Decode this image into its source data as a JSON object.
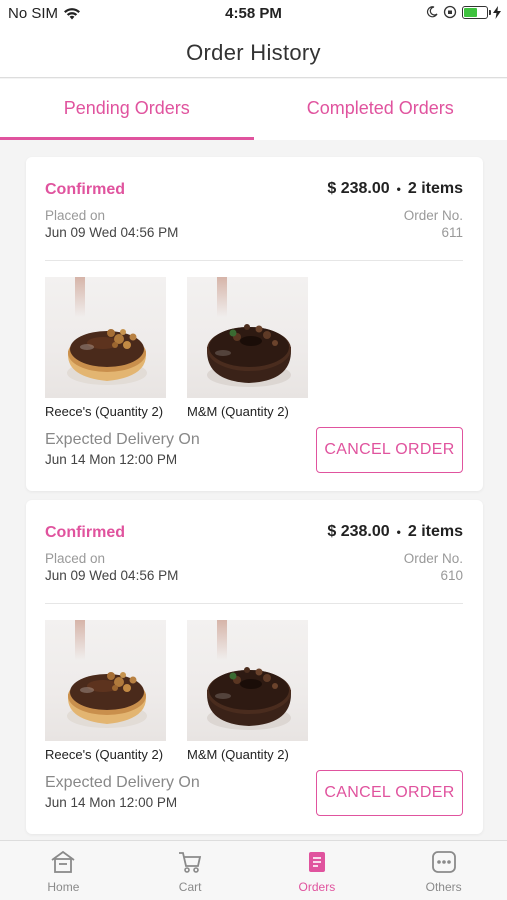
{
  "status_bar": {
    "carrier": "No SIM",
    "time": "4:58 PM"
  },
  "header": {
    "title": "Order History"
  },
  "tabs": [
    {
      "label": "Pending Orders",
      "active": true
    },
    {
      "label": "Completed Orders",
      "active": false
    }
  ],
  "orders": [
    {
      "status": "Confirmed",
      "amount": "$ 238.00",
      "separator": "•",
      "item_count": "2 items",
      "placed_label": "Placed on",
      "placed_date": "Jun 09 Wed 04:56 PM",
      "order_no_label": "Order No.",
      "order_no": "611",
      "items": [
        {
          "name": "Reece's (Quantity 2)",
          "image": "donut-reeces"
        },
        {
          "name": "M&M  (Quantity 2)",
          "image": "donut-mm"
        }
      ],
      "expected_label": "Expected Delivery On",
      "expected_date": "Jun 14 Mon 12:00 PM",
      "cancel_label": "CANCEL ORDER"
    },
    {
      "status": "Confirmed",
      "amount": "$ 238.00",
      "separator": "•",
      "item_count": "2 items",
      "placed_label": "Placed on",
      "placed_date": "Jun 09 Wed 04:56 PM",
      "order_no_label": "Order No.",
      "order_no": "610",
      "items": [
        {
          "name": "Reece's (Quantity 2)",
          "image": "donut-reeces"
        },
        {
          "name": "M&M  (Quantity 2)",
          "image": "donut-mm"
        }
      ],
      "expected_label": "Expected Delivery On",
      "expected_date": "Jun 14 Mon 12:00 PM",
      "cancel_label": "CANCEL ORDER"
    }
  ],
  "bottom_nav": [
    {
      "label": "Home",
      "icon": "home-icon",
      "active": false
    },
    {
      "label": "Cart",
      "icon": "cart-icon",
      "active": false
    },
    {
      "label": "Orders",
      "icon": "orders-icon",
      "active": true
    },
    {
      "label": "Others",
      "icon": "more-icon",
      "active": false
    }
  ],
  "colors": {
    "accent": "#e0539e",
    "battery": "#3ec23e"
  }
}
